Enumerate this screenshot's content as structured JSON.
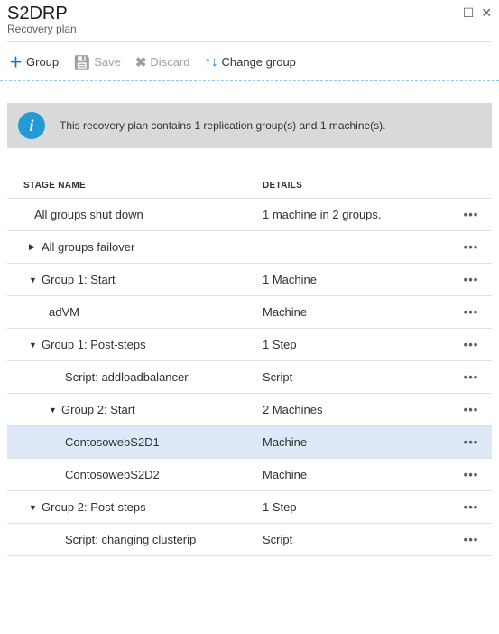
{
  "header": {
    "title": "S2DRP",
    "subtitle": "Recovery plan"
  },
  "toolbar": {
    "group_label": "Group",
    "save_label": "Save",
    "discard_label": "Discard",
    "change_group_label": "Change group"
  },
  "banner": {
    "message": "This recovery plan contains 1 replication group(s) and 1 machine(s)."
  },
  "columns": {
    "name": "STAGE NAME",
    "details": "DETAILS"
  },
  "rows": [
    {
      "name": "All groups shut down",
      "details": "1 machine in 2 groups.",
      "indent": "indent-0",
      "chev": "",
      "selected": false
    },
    {
      "name": "All groups failover",
      "details": "",
      "indent": "indent-1",
      "chev": "▶",
      "selected": false
    },
    {
      "name": "Group 1: Start",
      "details": "1 Machine",
      "indent": "indent-1",
      "chev": "▼",
      "selected": false
    },
    {
      "name": "adVM",
      "details": "Machine",
      "indent": "indent-2",
      "chev": "",
      "selected": false
    },
    {
      "name": "Group 1: Post-steps",
      "details": "1 Step",
      "indent": "indent-1",
      "chev": "▼",
      "selected": false
    },
    {
      "name": "Script: addloadbalancer",
      "details": "Script",
      "indent": "indent-3",
      "chev": "",
      "selected": false
    },
    {
      "name": "Group 2: Start",
      "details": "2 Machines",
      "indent": "indent-2",
      "chev": "▼",
      "selected": false
    },
    {
      "name": "ContosowebS2D1",
      "details": "Machine",
      "indent": "indent-3",
      "chev": "",
      "selected": true
    },
    {
      "name": "ContosowebS2D2",
      "details": "Machine",
      "indent": "indent-3",
      "chev": "",
      "selected": false
    },
    {
      "name": "Group 2: Post-steps",
      "details": "1 Step",
      "indent": "indent-1",
      "chev": "▼",
      "selected": false
    },
    {
      "name": "Script: changing clusterip",
      "details": "Script",
      "indent": "indent-3",
      "chev": "",
      "selected": false
    }
  ]
}
